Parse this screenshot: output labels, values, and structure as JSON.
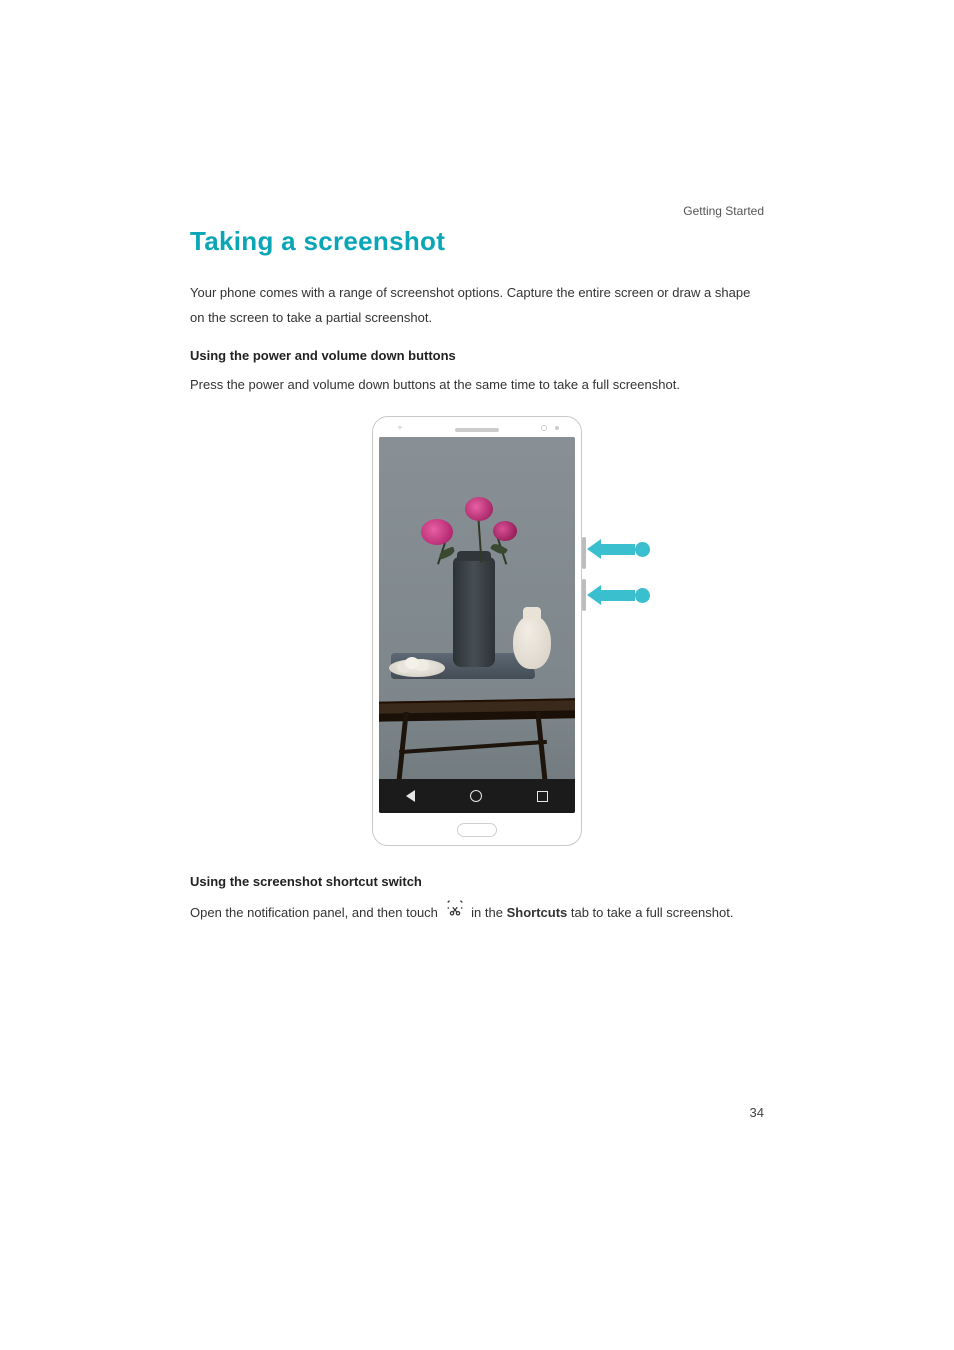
{
  "chapter": "Getting Started",
  "title": "Taking a screenshot",
  "intro": "Your phone comes with a range of screenshot options. Capture the entire screen or draw a shape on the screen to take a partial screenshot.",
  "section1_heading": "Using the power and volume down buttons",
  "section1_body": "Press the power and volume down buttons at the same time to take a full screenshot.",
  "section2_heading": "Using the screenshot shortcut switch",
  "section2_prefix": "Open the notification panel, and then touch ",
  "section2_mid": " in the ",
  "section2_bold": "Shortcuts",
  "section2_suffix": " tab to take a full screenshot.",
  "page_number": "34",
  "icon_label": "screenshot-scissors-icon"
}
